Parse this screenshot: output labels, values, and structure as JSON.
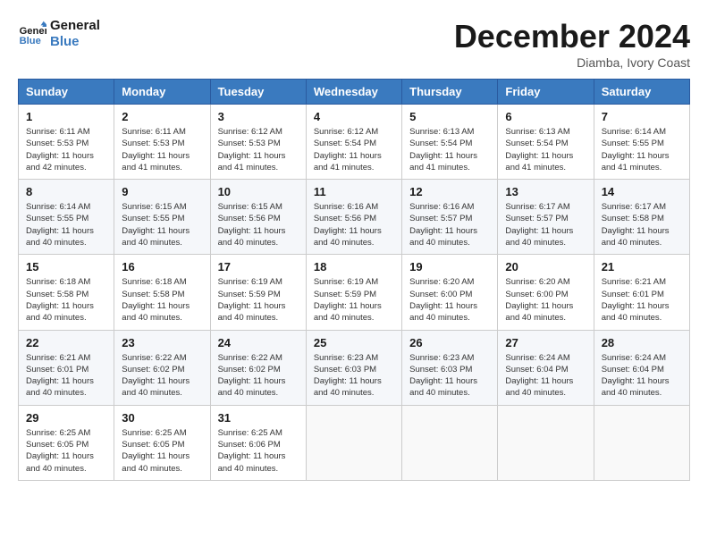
{
  "header": {
    "logo_line1": "General",
    "logo_line2": "Blue",
    "month": "December 2024",
    "location": "Diamba, Ivory Coast"
  },
  "days_of_week": [
    "Sunday",
    "Monday",
    "Tuesday",
    "Wednesday",
    "Thursday",
    "Friday",
    "Saturday"
  ],
  "weeks": [
    [
      {
        "day": "1",
        "sunrise": "6:11 AM",
        "sunset": "5:53 PM",
        "daylight": "11 hours and 42 minutes."
      },
      {
        "day": "2",
        "sunrise": "6:11 AM",
        "sunset": "5:53 PM",
        "daylight": "11 hours and 41 minutes."
      },
      {
        "day": "3",
        "sunrise": "6:12 AM",
        "sunset": "5:53 PM",
        "daylight": "11 hours and 41 minutes."
      },
      {
        "day": "4",
        "sunrise": "6:12 AM",
        "sunset": "5:54 PM",
        "daylight": "11 hours and 41 minutes."
      },
      {
        "day": "5",
        "sunrise": "6:13 AM",
        "sunset": "5:54 PM",
        "daylight": "11 hours and 41 minutes."
      },
      {
        "day": "6",
        "sunrise": "6:13 AM",
        "sunset": "5:54 PM",
        "daylight": "11 hours and 41 minutes."
      },
      {
        "day": "7",
        "sunrise": "6:14 AM",
        "sunset": "5:55 PM",
        "daylight": "11 hours and 41 minutes."
      }
    ],
    [
      {
        "day": "8",
        "sunrise": "6:14 AM",
        "sunset": "5:55 PM",
        "daylight": "11 hours and 40 minutes."
      },
      {
        "day": "9",
        "sunrise": "6:15 AM",
        "sunset": "5:55 PM",
        "daylight": "11 hours and 40 minutes."
      },
      {
        "day": "10",
        "sunrise": "6:15 AM",
        "sunset": "5:56 PM",
        "daylight": "11 hours and 40 minutes."
      },
      {
        "day": "11",
        "sunrise": "6:16 AM",
        "sunset": "5:56 PM",
        "daylight": "11 hours and 40 minutes."
      },
      {
        "day": "12",
        "sunrise": "6:16 AM",
        "sunset": "5:57 PM",
        "daylight": "11 hours and 40 minutes."
      },
      {
        "day": "13",
        "sunrise": "6:17 AM",
        "sunset": "5:57 PM",
        "daylight": "11 hours and 40 minutes."
      },
      {
        "day": "14",
        "sunrise": "6:17 AM",
        "sunset": "5:58 PM",
        "daylight": "11 hours and 40 minutes."
      }
    ],
    [
      {
        "day": "15",
        "sunrise": "6:18 AM",
        "sunset": "5:58 PM",
        "daylight": "11 hours and 40 minutes."
      },
      {
        "day": "16",
        "sunrise": "6:18 AM",
        "sunset": "5:58 PM",
        "daylight": "11 hours and 40 minutes."
      },
      {
        "day": "17",
        "sunrise": "6:19 AM",
        "sunset": "5:59 PM",
        "daylight": "11 hours and 40 minutes."
      },
      {
        "day": "18",
        "sunrise": "6:19 AM",
        "sunset": "5:59 PM",
        "daylight": "11 hours and 40 minutes."
      },
      {
        "day": "19",
        "sunrise": "6:20 AM",
        "sunset": "6:00 PM",
        "daylight": "11 hours and 40 minutes."
      },
      {
        "day": "20",
        "sunrise": "6:20 AM",
        "sunset": "6:00 PM",
        "daylight": "11 hours and 40 minutes."
      },
      {
        "day": "21",
        "sunrise": "6:21 AM",
        "sunset": "6:01 PM",
        "daylight": "11 hours and 40 minutes."
      }
    ],
    [
      {
        "day": "22",
        "sunrise": "6:21 AM",
        "sunset": "6:01 PM",
        "daylight": "11 hours and 40 minutes."
      },
      {
        "day": "23",
        "sunrise": "6:22 AM",
        "sunset": "6:02 PM",
        "daylight": "11 hours and 40 minutes."
      },
      {
        "day": "24",
        "sunrise": "6:22 AM",
        "sunset": "6:02 PM",
        "daylight": "11 hours and 40 minutes."
      },
      {
        "day": "25",
        "sunrise": "6:23 AM",
        "sunset": "6:03 PM",
        "daylight": "11 hours and 40 minutes."
      },
      {
        "day": "26",
        "sunrise": "6:23 AM",
        "sunset": "6:03 PM",
        "daylight": "11 hours and 40 minutes."
      },
      {
        "day": "27",
        "sunrise": "6:24 AM",
        "sunset": "6:04 PM",
        "daylight": "11 hours and 40 minutes."
      },
      {
        "day": "28",
        "sunrise": "6:24 AM",
        "sunset": "6:04 PM",
        "daylight": "11 hours and 40 minutes."
      }
    ],
    [
      {
        "day": "29",
        "sunrise": "6:25 AM",
        "sunset": "6:05 PM",
        "daylight": "11 hours and 40 minutes."
      },
      {
        "day": "30",
        "sunrise": "6:25 AM",
        "sunset": "6:05 PM",
        "daylight": "11 hours and 40 minutes."
      },
      {
        "day": "31",
        "sunrise": "6:25 AM",
        "sunset": "6:06 PM",
        "daylight": "11 hours and 40 minutes."
      },
      null,
      null,
      null,
      null
    ]
  ]
}
